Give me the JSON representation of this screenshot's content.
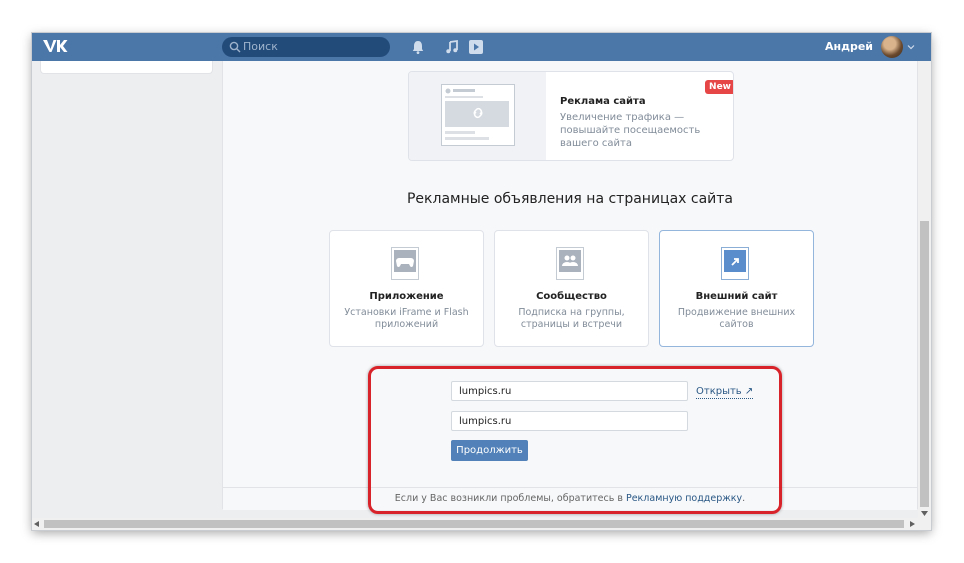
{
  "header": {
    "search_placeholder": "Поиск",
    "user_name": "Андрей",
    "icons": [
      "vk-logo-icon",
      "search-icon",
      "bell-icon",
      "music-icon",
      "play-icon",
      "chevron-down-icon"
    ]
  },
  "site_ad": {
    "badge": "New",
    "title": "Реклама сайта",
    "description": "Увеличение трафика — повышайте посещаемость вашего сайта"
  },
  "section_heading": "Рекламные объявления на страницах сайта",
  "ad_types": [
    {
      "title": "Приложение",
      "description": "Установки iFrame и Flash приложений",
      "icon": "gamepad-icon",
      "selected": false
    },
    {
      "title": "Сообщество",
      "description": "Подписка на группы, страницы и встречи",
      "icon": "community-icon",
      "selected": false
    },
    {
      "title": "Внешний сайт",
      "description": "Продвижение внешних сайтов",
      "icon": "external-link-icon",
      "selected": true
    }
  ],
  "form": {
    "url_value": "lumpics.ru",
    "domain_value": "lumpics.ru",
    "open_link": "Открыть",
    "continue_button": "Продолжить"
  },
  "footer": {
    "text_before": "Если у Вас возникли проблемы, обратитесь в ",
    "link": "Рекламную поддержку",
    "text_after": "."
  },
  "colors": {
    "header_bg": "#4a76a8",
    "accent": "#5181b8",
    "highlight_frame": "#d8232a",
    "badge": "#e64646"
  }
}
